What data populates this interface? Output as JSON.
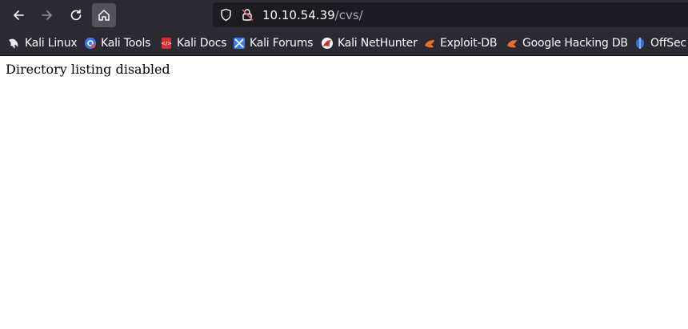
{
  "browser": {
    "url_host": "10.10.54.39",
    "url_path": "/cvs/"
  },
  "bookmarks": [
    {
      "label": "Kali Linux",
      "icon": "kali-dragon-icon"
    },
    {
      "label": "Kali Tools",
      "icon": "kali-tools-icon"
    },
    {
      "label": "Kali Docs",
      "icon": "kali-docs-icon"
    },
    {
      "label": "Kali Forums",
      "icon": "kali-forums-icon"
    },
    {
      "label": "Kali NetHunter",
      "icon": "kali-nethunter-icon"
    },
    {
      "label": "Exploit-DB",
      "icon": "exploit-db-icon"
    },
    {
      "label": "Google Hacking DB",
      "icon": "ghdb-icon"
    },
    {
      "label": "OffSec",
      "icon": "offsec-icon"
    }
  ],
  "page": {
    "message": "Directory listing disabled"
  },
  "colors": {
    "toolbar_bg": "#2b2a33",
    "urlbar_bg": "#1c1b22",
    "text_light": "#fbfbfe",
    "text_dim": "#a9a9b1"
  }
}
